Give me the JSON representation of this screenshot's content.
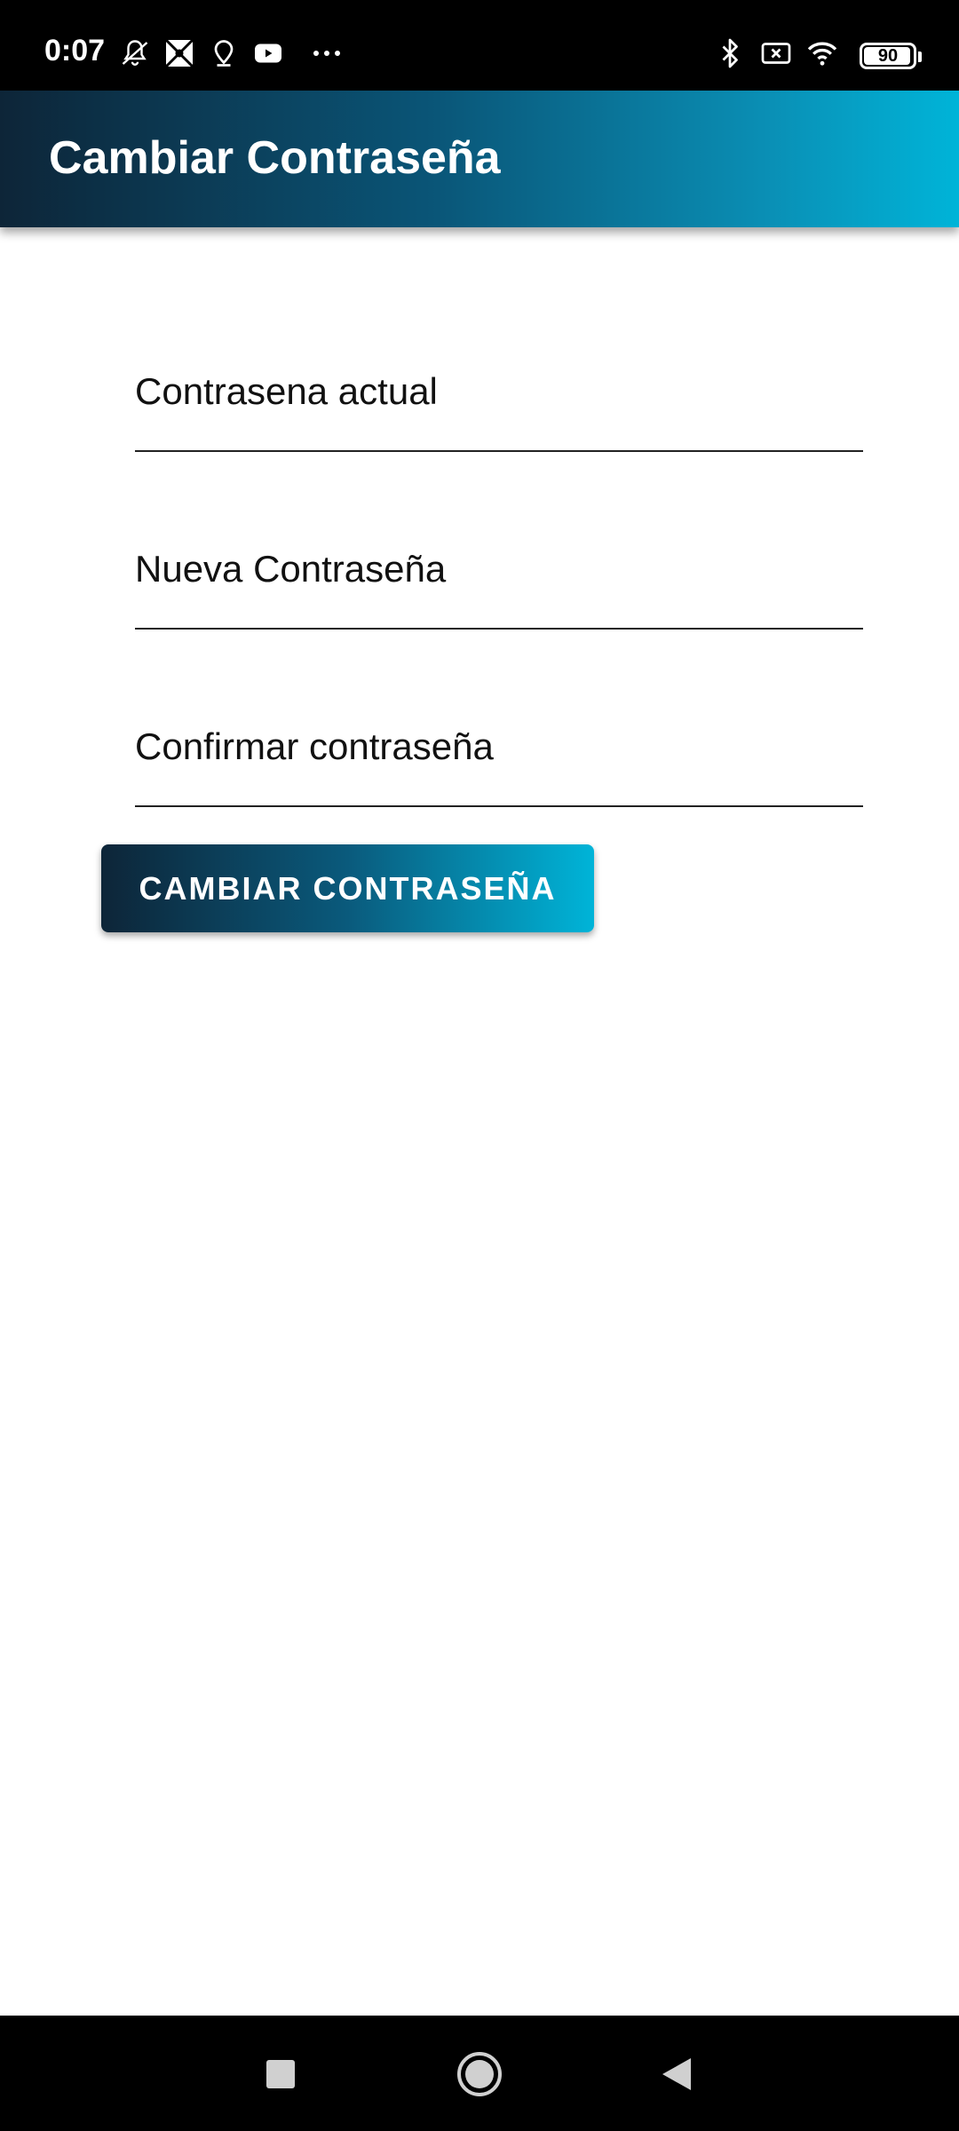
{
  "status_bar": {
    "time": "0:07",
    "battery_level": "90",
    "icons_left": [
      "notifications-off-icon",
      "photo-app-icon",
      "location-pin-icon",
      "youtube-icon",
      "more-dots-icon"
    ],
    "icons_right": [
      "bluetooth-icon",
      "no-sim-icon",
      "wifi-icon",
      "battery-icon"
    ]
  },
  "app_bar": {
    "title": "Cambiar Contraseña",
    "gradient_start": "#0d2538",
    "gradient_end": "#00b4d8"
  },
  "form": {
    "current_password": {
      "placeholder": "Contrasena actual",
      "value": ""
    },
    "new_password": {
      "placeholder": "Nueva Contraseña",
      "value": ""
    },
    "confirm_password": {
      "placeholder": "Confirmar contraseña",
      "value": ""
    },
    "submit_label": "CAMBIAR CONTRASEÑA"
  },
  "nav_bar": {
    "buttons": [
      "recents-square-icon",
      "home-circle-icon",
      "back-triangle-icon"
    ]
  }
}
